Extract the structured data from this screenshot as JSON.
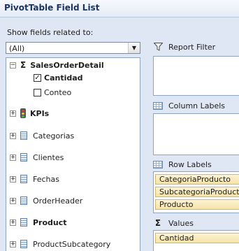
{
  "title": "PivotTable Field List",
  "show_fields_label": "Show fields related to:",
  "combo": {
    "value": "(All)"
  },
  "tree": {
    "sales_order_detail": "SalesOrderDetail",
    "cantidad": "Cantidad",
    "conteo": "Conteo",
    "kpis": "KPIs",
    "categorias": "Categorias",
    "clientes": "Clientes",
    "fechas": "Fechas",
    "order_header": "OrderHeader",
    "product": "Product",
    "product_subcategory": "ProductSubcategory"
  },
  "tree_checked": {
    "cantidad": true,
    "conteo": false
  },
  "areas": {
    "report_filter": "Report Filter",
    "column_labels": "Column Labels",
    "row_labels": "Row Labels",
    "values": "Values"
  },
  "row_fields": [
    "CategoriaProducto",
    "SubcategoriaProducto",
    "Producto"
  ],
  "value_fields": [
    "Cantidad"
  ],
  "icons": {
    "funnel": "funnel-icon",
    "grid": "grid-icon",
    "sigma": "sigma-icon",
    "table": "table-icon",
    "kpi": "traffic-light-icon"
  },
  "colors": {
    "background": "#dee7f3",
    "chip": "#f7e7b4",
    "title": "#1a3561"
  }
}
